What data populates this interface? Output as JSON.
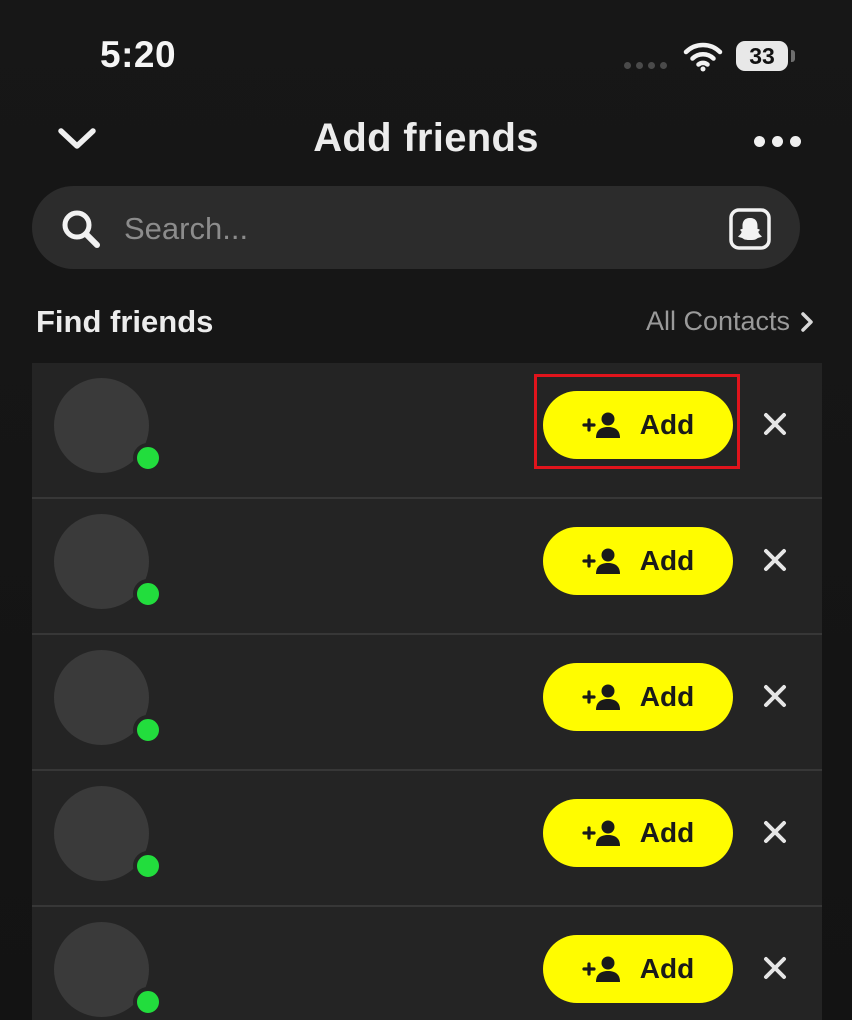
{
  "status_bar": {
    "time": "5:20",
    "battery": "33"
  },
  "header": {
    "title": "Add friends",
    "back_icon": "chevron-down-icon",
    "menu_icon": "more-horizontal-icon"
  },
  "search": {
    "placeholder": "Search...",
    "value": "",
    "left_icon": "search-icon",
    "right_icon": "snapcode-scan-icon"
  },
  "section": {
    "title": "Find friends",
    "link_label": "All Contacts"
  },
  "friends": [
    {
      "add_label": "Add",
      "online": true,
      "highlighted": true
    },
    {
      "add_label": "Add",
      "online": true,
      "highlighted": false
    },
    {
      "add_label": "Add",
      "online": true,
      "highlighted": false
    },
    {
      "add_label": "Add",
      "online": true,
      "highlighted": false
    },
    {
      "add_label": "Add",
      "online": true,
      "highlighted": false
    }
  ],
  "colors": {
    "background": "#151515",
    "row_background": "#242424",
    "accent_yellow": "#FFFC00",
    "online_green": "#22DD3D",
    "highlight_red": "#E0141C"
  }
}
